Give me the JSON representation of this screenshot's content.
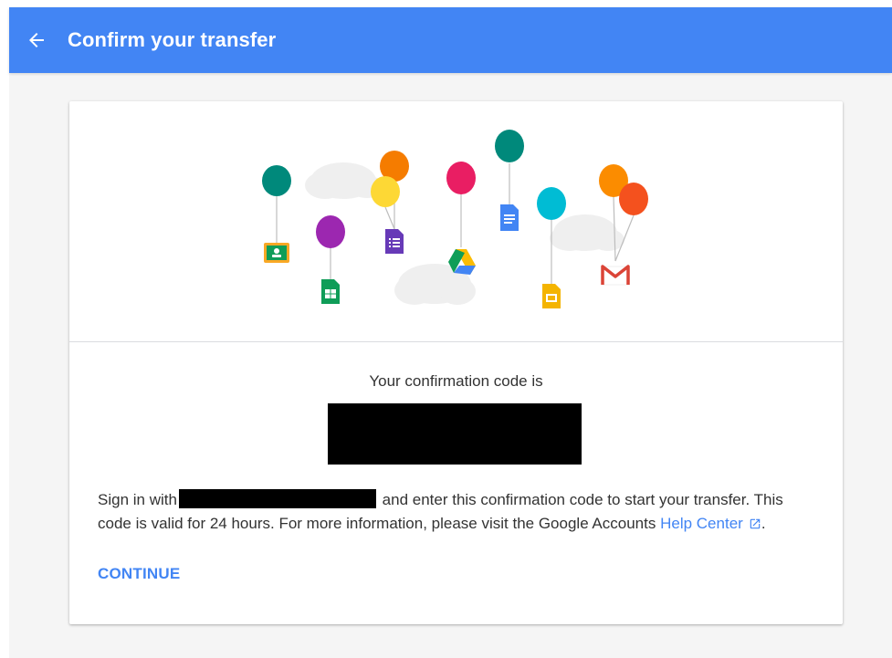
{
  "header": {
    "title": "Confirm your transfer",
    "back_icon": "arrow-back-icon"
  },
  "colors": {
    "appbar": "#4285f4",
    "accent": "#4285f4"
  },
  "confirmation": {
    "label": "Your confirmation code is",
    "code": ""
  },
  "message": {
    "before_account": "Sign in with",
    "account": "",
    "after_account": " and enter this confirmation code to start your transfer. This code is valid for 24 hours. For more information, please visit the Google Accounts ",
    "link": "Help Center",
    "end": "."
  },
  "actions": {
    "continue_label": "CONTINUE"
  },
  "illustration": {
    "icons": [
      "classroom-icon",
      "sheets-icon",
      "forms-icon",
      "drive-icon",
      "docs-icon",
      "slides-icon",
      "gmail-icon"
    ]
  }
}
